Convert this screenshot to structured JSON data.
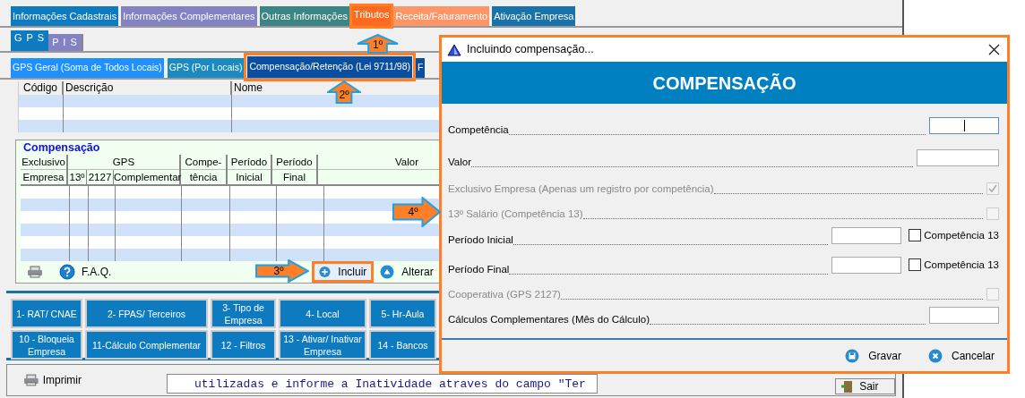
{
  "main_tabs": [
    {
      "label": "Informações Cadastrais",
      "color": "#0e7ac0",
      "selected": false,
      "highlighted": false
    },
    {
      "label": "Informações Complementares",
      "color": "#8383c3",
      "selected": false,
      "highlighted": false
    },
    {
      "label": "Outras Informações",
      "color": "#3c8585",
      "selected": false,
      "highlighted": false
    },
    {
      "label": "Tributos",
      "color": "#ff6a20",
      "selected": true,
      "highlighted": true
    },
    {
      "label": "Receita/Faturamento",
      "color": "#ff9466",
      "selected": false,
      "highlighted": false
    },
    {
      "label": "Ativação Empresa",
      "color": "#1a72aa",
      "selected": false,
      "highlighted": false
    }
  ],
  "gps_tabs": [
    {
      "label": "G P S",
      "color": "#0e7ac0",
      "selected": true
    },
    {
      "label": "P I S",
      "color": "#8383c3",
      "selected": false
    }
  ],
  "sub_tabs": [
    {
      "label": "GPS Geral (Soma de Todos Locais)",
      "color": "#1e90ff",
      "selected": false,
      "highlighted": false
    },
    {
      "label": "GPS (Por Locais)",
      "color": "#1a8ac0",
      "selected": false,
      "highlighted": false
    },
    {
      "label": "Compensação/Retenção (Lei 9711/98)",
      "color": "#0a4f9f",
      "selected": true,
      "highlighted": true
    },
    {
      "label": "F",
      "color": "#0a4f9f",
      "selected": false,
      "highlighted": false
    }
  ],
  "list_table": {
    "columns": [
      "Código",
      "Descrição",
      "Nome"
    ]
  },
  "compensation": {
    "title": "Compensação",
    "columns": [
      {
        "top": "Exclusivo",
        "bottom": "Empresa"
      },
      {
        "top": "GPS",
        "subs": [
          "13º",
          "2127",
          "Complementar"
        ]
      },
      {
        "top": "Compe-",
        "bottom": "tência"
      },
      {
        "top": "Período",
        "bottom": "Inicial"
      },
      {
        "top": "Período",
        "bottom": "Final"
      },
      {
        "top": "Valor"
      }
    ],
    "faq": "F.A.Q.",
    "buttons": [
      {
        "label": "Incluir",
        "highlighted": true
      },
      {
        "label": "Alterar",
        "highlighted": false
      }
    ]
  },
  "function_buttons": [
    [
      "1- RAT/ CNAE",
      "2- FPAS/ Terceiros",
      "3- Tipo de Empresa",
      "4- Local",
      "5- Hr-Aula"
    ],
    [
      "10 - Bloqueia Empresa",
      "11-Cálculo Complementar",
      "12 - Filtros",
      "13 - Ativar/ Inativar Empresa",
      "14 - Bancos"
    ]
  ],
  "bottom_bar": {
    "print": "Imprimir",
    "message": "utilizadas e informe a Inatividade atraves do campo \"Ter",
    "exit": "Sair"
  },
  "callouts": [
    {
      "label": "1º"
    },
    {
      "label": "2º"
    },
    {
      "label": "3º"
    },
    {
      "label": "4º"
    }
  ],
  "dialog": {
    "title": "Incluindo compensação...",
    "header": "COMPENSAÇÃO",
    "rows": [
      {
        "kind": "field",
        "label": "Competência",
        "disabled": false,
        "focused": true
      },
      {
        "kind": "field",
        "label": "Valor",
        "disabled": false,
        "focused": false
      },
      {
        "kind": "checkbox",
        "label": "Exclusivo Empresa (Apenas um registro por competência)",
        "disabled": true,
        "checked": true
      },
      {
        "kind": "checkbox",
        "label": "13º Salário (Competência 13)",
        "disabled": true,
        "checked": false
      },
      {
        "kind": "field_check",
        "label": "Período Inicial",
        "disabled": false,
        "focused": false,
        "check_label": "Competência 13",
        "checked": false
      },
      {
        "kind": "field_check",
        "label": "Período Final",
        "disabled": false,
        "focused": false,
        "check_label": "Competência 13",
        "checked": false
      },
      {
        "kind": "checkbox",
        "label": "Cooperativa (GPS 2127)",
        "disabled": true,
        "checked": false
      },
      {
        "kind": "field",
        "label": "Cálculos Complementares (Mês do Cálculo)",
        "disabled": false,
        "focused": false
      }
    ],
    "buttons": [
      {
        "label": "Gravar"
      },
      {
        "label": "Cancelar"
      }
    ]
  }
}
